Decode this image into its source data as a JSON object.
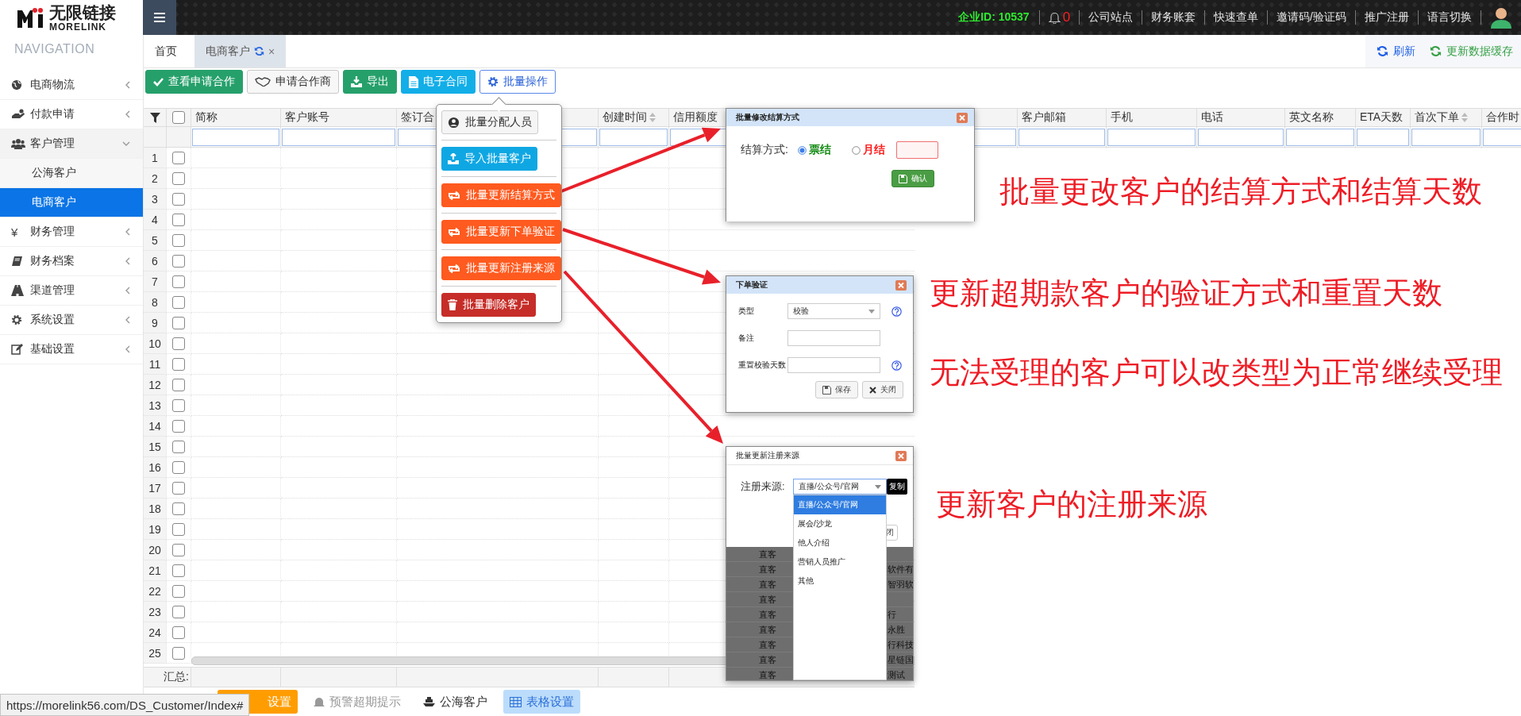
{
  "top_bar": {
    "logo_title": "无限链接",
    "logo_subtitle": "MORELINK",
    "company_id_label": "企业ID:",
    "company_id": "10537",
    "notification_count": "0",
    "links": [
      "公司站点",
      "财务账套",
      "快速查单",
      "邀请码/验证码",
      "推广注册",
      "语言切换"
    ]
  },
  "sidebar": {
    "heading": "NAVIGATION",
    "items": [
      {
        "label": "电商物流",
        "kind": "globe",
        "expanded": false,
        "selected": false
      },
      {
        "label": "付款申请",
        "kind": "pay",
        "expanded": false,
        "selected": false
      },
      {
        "label": "客户管理",
        "kind": "users",
        "expanded": true,
        "selected": false,
        "children": [
          {
            "label": "公海客户",
            "selected": false
          },
          {
            "label": "电商客户",
            "selected": true
          }
        ]
      },
      {
        "label": "财务管理",
        "kind": "symbol",
        "symbol": "¥",
        "expanded": false,
        "selected": false
      },
      {
        "label": "财务档案",
        "kind": "book",
        "expanded": false,
        "selected": false
      },
      {
        "label": "渠道管理",
        "kind": "road",
        "expanded": false,
        "selected": false
      },
      {
        "label": "系统设置",
        "kind": "gear",
        "expanded": false,
        "selected": false
      },
      {
        "label": "基础设置",
        "kind": "edit",
        "expanded": false,
        "selected": false
      }
    ]
  },
  "tabs": [
    {
      "label": "首页",
      "selected": false
    },
    {
      "label": "电商客户",
      "selected": true,
      "close": "×"
    }
  ],
  "tab_actions": [
    {
      "label": "刷新",
      "kind": "refresh"
    },
    {
      "label": "更新数据缓存",
      "kind": "cache"
    }
  ],
  "toolbar": [
    {
      "label": "查看申请合作",
      "kind": "check"
    },
    {
      "label": "申请合作商",
      "kind": "handshake"
    },
    {
      "label": "导出",
      "kind": "export"
    },
    {
      "label": "电子合同",
      "kind": "contract"
    },
    {
      "label": "批量操作",
      "kind": "batch"
    }
  ],
  "table": {
    "header_checked": false,
    "columns": [
      {
        "label": "简称",
        "sortable": false
      },
      {
        "label": "客户账号",
        "sortable": false
      },
      {
        "label": "签订合"
      },
      {
        "label": "创建时间",
        "sortable": true
      },
      {
        "label": "信用额度",
        "sortable": false
      },
      {
        "label": "客户邮箱",
        "sortable": false
      },
      {
        "label": "手机",
        "sortable": false
      },
      {
        "label": "电话",
        "sortable": false
      },
      {
        "label": "英文名称",
        "sortable": false
      },
      {
        "label": "ETA天数",
        "sortable": false
      },
      {
        "label": "首次下单",
        "sortable": true
      },
      {
        "label": "合作时"
      }
    ],
    "rows": [
      {
        "number": "1",
        "checked": false
      },
      {
        "number": "2",
        "checked": false
      },
      {
        "number": "3",
        "checked": false
      },
      {
        "number": "4",
        "checked": false
      },
      {
        "number": "5",
        "checked": false
      },
      {
        "number": "6",
        "checked": false
      },
      {
        "number": "7",
        "checked": false
      },
      {
        "number": "8",
        "checked": false
      },
      {
        "number": "9",
        "checked": false
      },
      {
        "number": "10",
        "checked": false
      },
      {
        "number": "11",
        "checked": false
      },
      {
        "number": "12",
        "checked": false
      },
      {
        "number": "13",
        "checked": false
      },
      {
        "number": "14",
        "checked": false
      },
      {
        "number": "15",
        "checked": false
      },
      {
        "number": "16",
        "checked": false
      },
      {
        "number": "17",
        "checked": false
      },
      {
        "number": "18",
        "checked": false
      },
      {
        "number": "19",
        "checked": false
      },
      {
        "number": "20",
        "checked": false
      },
      {
        "number": "21",
        "checked": false
      },
      {
        "number": "22",
        "checked": false
      },
      {
        "number": "23",
        "checked": false
      },
      {
        "number": "24",
        "checked": false
      },
      {
        "number": "25",
        "checked": false
      }
    ],
    "summary_label": "汇总:"
  },
  "batch_menu": {
    "items": [
      {
        "label": "批量分配人员",
        "kind": "assign"
      },
      {
        "label": "导入批量客户",
        "kind": "import"
      },
      {
        "label": "批量更新结算方式",
        "kind": "update"
      },
      {
        "label": "批量更新下单验证",
        "kind": "update"
      },
      {
        "label": "批量更新注册来源",
        "kind": "update"
      },
      {
        "label": "批量删除客户",
        "kind": "delete"
      }
    ]
  },
  "settlement_dialog": {
    "title": "批量修改结算方式",
    "field_label": "结算方式:",
    "options": [
      {
        "label": "票结",
        "selected": true,
        "color": "#138a13"
      },
      {
        "label": "月结",
        "selected": false,
        "color": "#ff1a1a"
      }
    ],
    "confirm": "确认"
  },
  "verify_dialog": {
    "title": "下单验证",
    "fields": [
      {
        "label": "类型",
        "kind": "select",
        "value": "校验",
        "help": true
      },
      {
        "label": "备注",
        "kind": "input",
        "help": false
      },
      {
        "label": "重置校验天数",
        "kind": "input",
        "help": true
      }
    ],
    "buttons": [
      {
        "label": "保存",
        "kind": "save"
      },
      {
        "label": "关闭",
        "kind": "close"
      }
    ]
  },
  "source_dialog": {
    "title": "批量更新注册来源",
    "field_label": "注册来源:",
    "value": "直播/公众号/官网",
    "copy_button": "复制",
    "partial_button": "闭",
    "options": [
      {
        "label": "直播/公众号/官网",
        "selected": true
      },
      {
        "label": "展会/沙龙",
        "selected": false
      },
      {
        "label": "他人介绍",
        "selected": false
      },
      {
        "label": "营销人员推广",
        "selected": false
      },
      {
        "label": "其他",
        "selected": false
      }
    ],
    "background_rows": [
      {
        "column_1": "直客"
      },
      {
        "column_1": "直客",
        "column_2": "软件有"
      },
      {
        "column_1": "直客",
        "column_2": "智羽软"
      },
      {
        "column_1": "直客"
      },
      {
        "column_1": "直客",
        "column_2": "行"
      },
      {
        "column_1": "直客",
        "column_2": "永胜"
      },
      {
        "column_1": "直客",
        "column_2": "行科技"
      },
      {
        "column_1": "直客",
        "column_2": "星链国"
      },
      {
        "column_1": "直客",
        "column_2": "测试"
      }
    ]
  },
  "annotations": [
    "批量更改客户的结算方式和结算天数",
    "更新超期款客户的验证方式和重置天数",
    "无法受理的客户可以改类型为正常继续受理",
    "更新客户的注册来源"
  ],
  "bottom_bar": [
    {
      "label": "设置",
      "kind": "orange"
    },
    {
      "label": "预警超期提示",
      "kind": "bell"
    },
    {
      "label": "公海客户",
      "kind": "ship"
    },
    {
      "label": "表格设置",
      "kind": "grid"
    }
  ],
  "status_url": "https://morelink56.com/DS_Customer/Index#"
}
